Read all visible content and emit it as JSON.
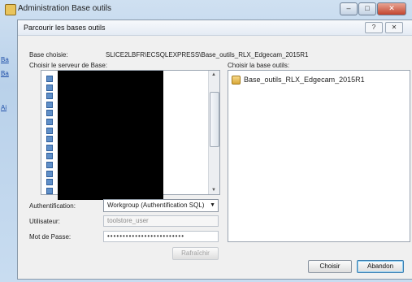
{
  "outer_window": {
    "title": "Administration Base outils",
    "side_links": [
      "Ba",
      "Ba",
      "Ai"
    ]
  },
  "dialog": {
    "title": "Parcourir les bases outils",
    "help_label": "?",
    "close_label": "✕"
  },
  "base_choisie": {
    "label": "Base choisie:",
    "value": "SLICE2LBFR\\ECSQLEXPRESS\\Base_outils_RLX_Edgecam_2015R1"
  },
  "server_list": {
    "label": "Choisir le serveur de Base:",
    "row_count": 14
  },
  "base_list": {
    "label": "Choisir la base outils:",
    "items": [
      "Base_outils_RLX_Edgecam_2015R1"
    ]
  },
  "auth": {
    "label": "Authentification:",
    "value": "Workgroup (Authentification SQL)"
  },
  "user": {
    "label": "Utilisateur:",
    "value": "toolstore_user"
  },
  "password": {
    "label": "Mot de Passe:",
    "value": "•••••••••••••••••••••••••"
  },
  "buttons": {
    "refresh": "Rafraîchir",
    "choose": "Choisir",
    "cancel": "Abandon"
  },
  "colors": {
    "accent": "#3c7fb1",
    "window_bg": "#f0f0f0"
  }
}
